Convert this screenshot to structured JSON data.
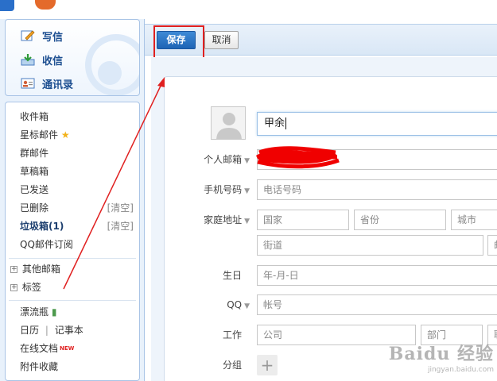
{
  "quick_actions": {
    "write": "写信",
    "receive": "收信",
    "contacts": "通讯录"
  },
  "folders": {
    "inbox": "收件箱",
    "starred": "星标邮件",
    "group": "群邮件",
    "drafts": "草稿箱",
    "sent": "已发送",
    "deleted": "已删除",
    "spam": "垃圾箱(1)",
    "clear": "[清空]",
    "qq_subscribe": "QQ邮件订阅",
    "other_mailbox": "其他邮箱",
    "tags": "标签",
    "drift_bottle": "漂流瓶",
    "calendar": "日历",
    "divider": "|",
    "notes": "记事本",
    "online_docs": "在线文档",
    "new_badge": "NEW",
    "attachments": "附件收藏"
  },
  "toolbar": {
    "save": "保存",
    "cancel": "取消"
  },
  "form": {
    "name_value": "甲余",
    "email_label": "个人邮箱",
    "phone_label": "手机号码",
    "phone_placeholder": "电话号码",
    "address_label": "家庭地址",
    "country_placeholder": "国家",
    "province_placeholder": "省份",
    "city_placeholder": "城市",
    "street_placeholder": "街道",
    "postcode_partial": "邮",
    "birthday_label": "生日",
    "birthday_placeholder": "年-月-日",
    "qq_label": "QQ",
    "qq_placeholder": "帐号",
    "work_label": "工作",
    "company_placeholder": "公司",
    "department_placeholder": "部门",
    "title_partial": "职",
    "group_label": "分组"
  },
  "watermark": {
    "brand": "Baidu 经验",
    "url": "jingyan.baidu.com"
  },
  "colors": {
    "accent": "#1e64b5",
    "annotation": "#e02020",
    "sidebar_border": "#a9c4e6"
  }
}
